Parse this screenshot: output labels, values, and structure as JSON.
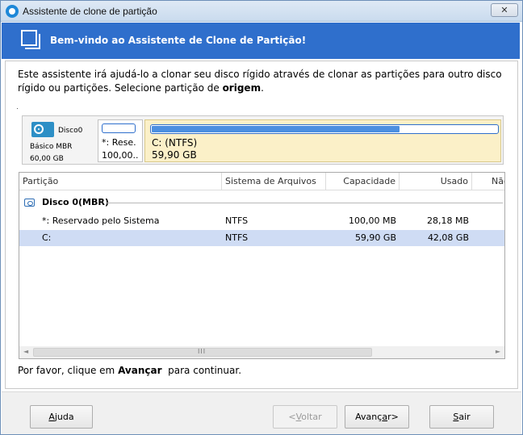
{
  "window": {
    "title": "Assistente de clone de partição",
    "close_glyph": "✕"
  },
  "banner": {
    "title": "Bem-vindo ao Assistente de Clone de Partição!",
    "icon": "copy-icon"
  },
  "intro": {
    "text": "Este assistente irá ajudá-lo a clonar seu disco rígido através de clonar as partições para outro disco rígido ou partições. Selecione partição de ",
    "emphasis": "origem",
    "end": "."
  },
  "disk_map": {
    "disk": {
      "name": "Disco0",
      "type": "Básico MBR",
      "size": "60,00 GB"
    },
    "partitions": [
      {
        "label": "*: Rese.",
        "size": "100,00.."
      },
      {
        "label": "C: (NTFS)",
        "size": "59,90 GB",
        "used_fraction": 0.715
      }
    ],
    "colors": {
      "selected_partition_bg": "#fbf0c8",
      "usage_fill": "#4c8fe0"
    }
  },
  "table": {
    "columns": [
      "Partição",
      "Sistema de Arquivos",
      "Capacidade",
      "Usado",
      "Não"
    ],
    "group": {
      "label": "Disco 0(MBR)"
    },
    "rows": [
      {
        "partition": "*: Reservado pelo Sistema",
        "fs": "NTFS",
        "capacity": "100,00 MB",
        "used": "28,18 MB",
        "trail": "'",
        "selected": false
      },
      {
        "partition": "C:",
        "fs": "NTFS",
        "capacity": "59,90 GB",
        "used": "42,08 GB",
        "trail": "",
        "selected": true
      }
    ],
    "scrollbar": {
      "left_arrow": "◄",
      "right_arrow": "►",
      "grip": "III"
    }
  },
  "footer": {
    "prefix": "Por favor, clique em ",
    "emphasis": "Avançar",
    "suffix": "  para continuar."
  },
  "buttons": {
    "help": {
      "label": "Ajuda",
      "mnemonic": "A",
      "rest": "juda"
    },
    "back": {
      "label": "<Voltar",
      "before": "<",
      "mnemonic": "V",
      "rest": "oltar"
    },
    "next": {
      "label": "Avançar>",
      "before": "Avanç",
      "mnemonic": "a",
      "rest": "r>"
    },
    "exit": {
      "label": "Sair",
      "mnemonic": "S",
      "rest": "air"
    }
  }
}
